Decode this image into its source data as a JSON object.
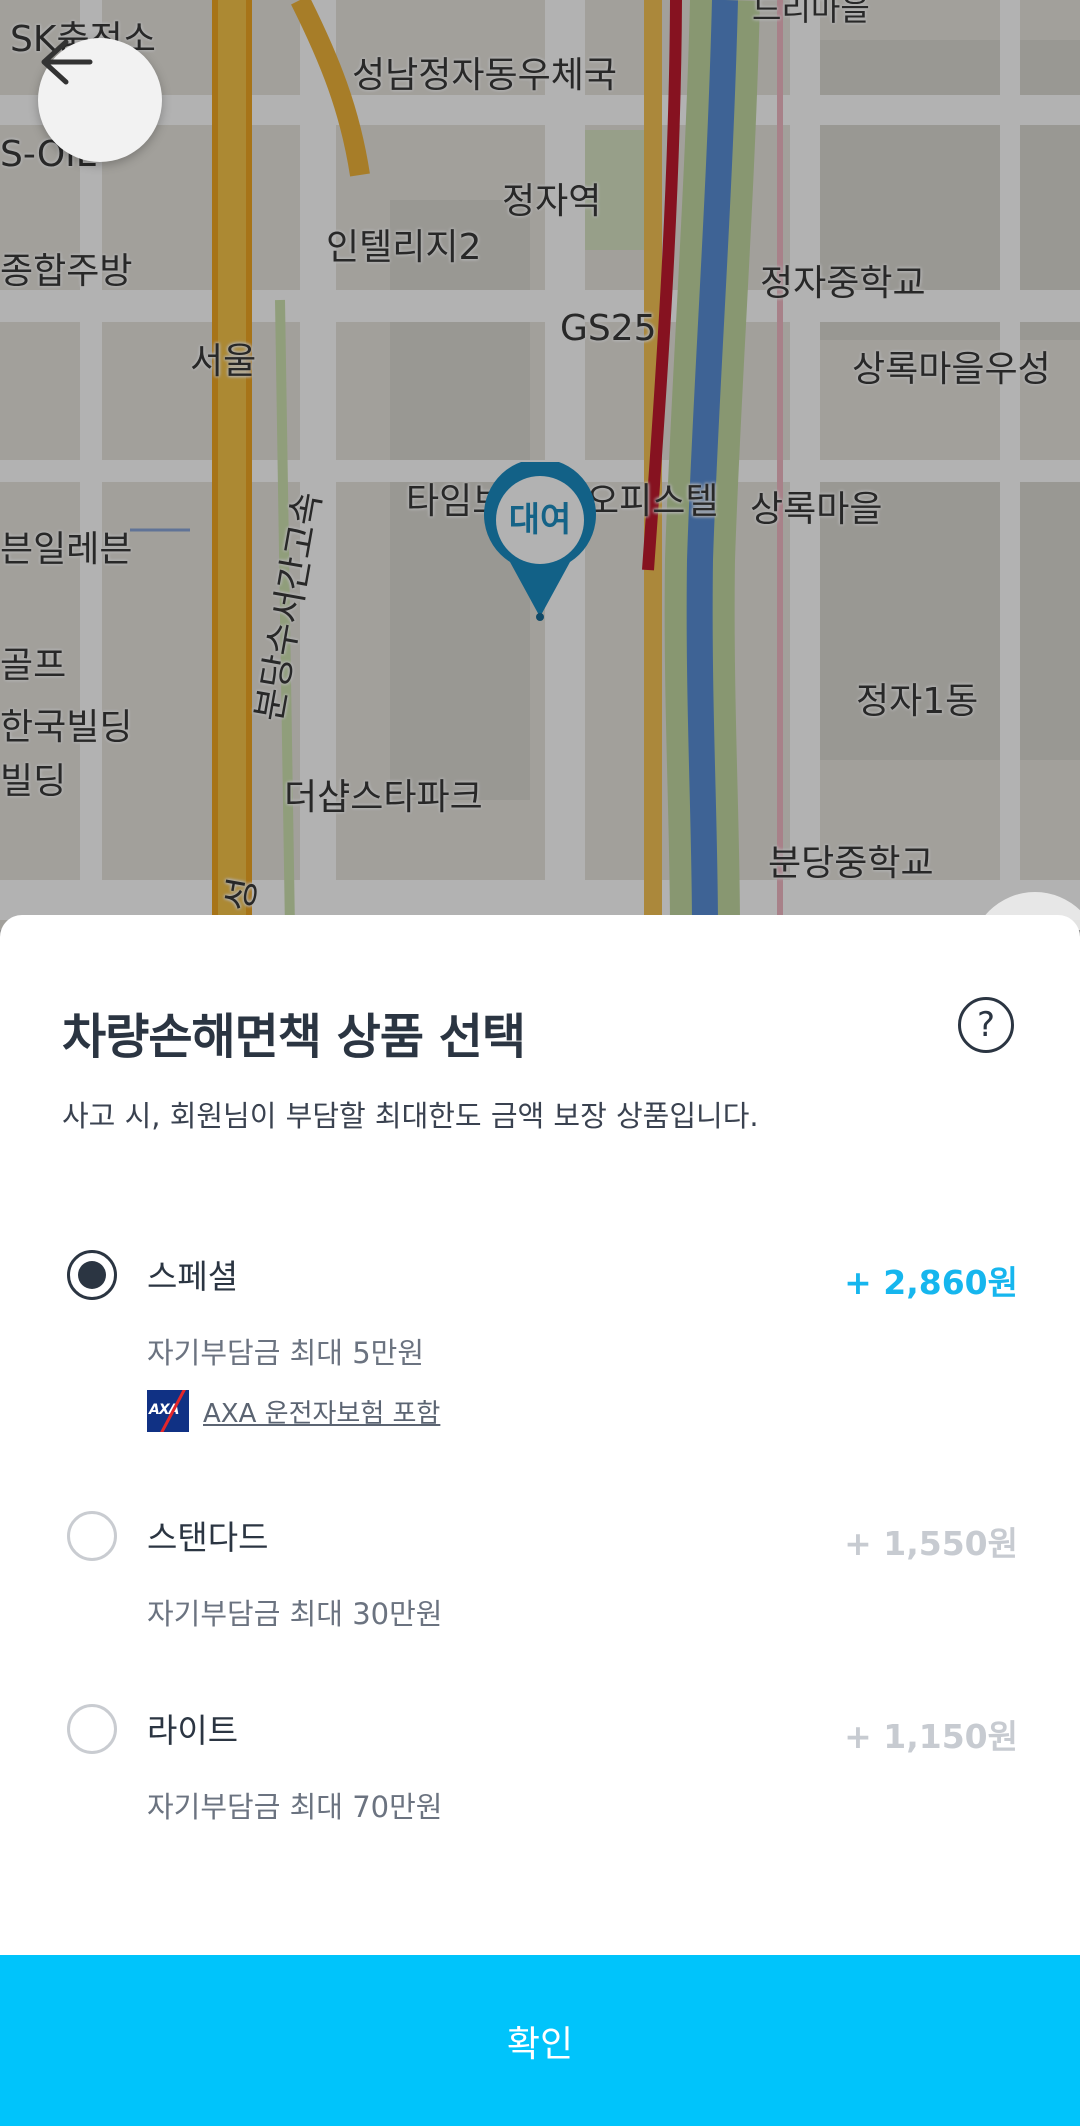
{
  "map": {
    "labels": [
      "SK충전소",
      "성남정자동우체국",
      "S-OIL",
      "정자역",
      "종합주방",
      "인텔리지2",
      "정자중학교",
      "서울",
      "GS25",
      "상록마을우성",
      "타임브",
      "오피스텔",
      "상록마을",
      "븐일레븐",
      "분당수서간고속",
      "골프",
      "한국빌딩",
      "빌딩",
      "정자1동",
      "더샵스타파크",
      "분당중학교",
      "드리마을",
      "성"
    ],
    "pin_label": "대여"
  },
  "sheet": {
    "title": "차량손해면책 상품 선택",
    "help_icon": "?",
    "subtitle": "사고 시, 회원님이 부담할 최대한도 금액 보장 상품입니다.",
    "options": [
      {
        "name": "스페셜",
        "price": "+ 2,860원",
        "desc": "자기부담금 최대 5만원",
        "insurance_logo": "AXA",
        "insurance_text": "AXA 운전자보험 포함",
        "selected": true
      },
      {
        "name": "스탠다드",
        "price": "+ 1,550원",
        "desc": "자기부담금 최대 30만원",
        "selected": false
      },
      {
        "name": "라이트",
        "price": "+ 1,150원",
        "desc": "자기부담금 최대 70만원",
        "selected": false
      }
    ],
    "confirm_label": "확인"
  },
  "colors": {
    "accent": "#00c4fb",
    "price_active": "#16b6ee",
    "text_dark": "#2b3542"
  }
}
